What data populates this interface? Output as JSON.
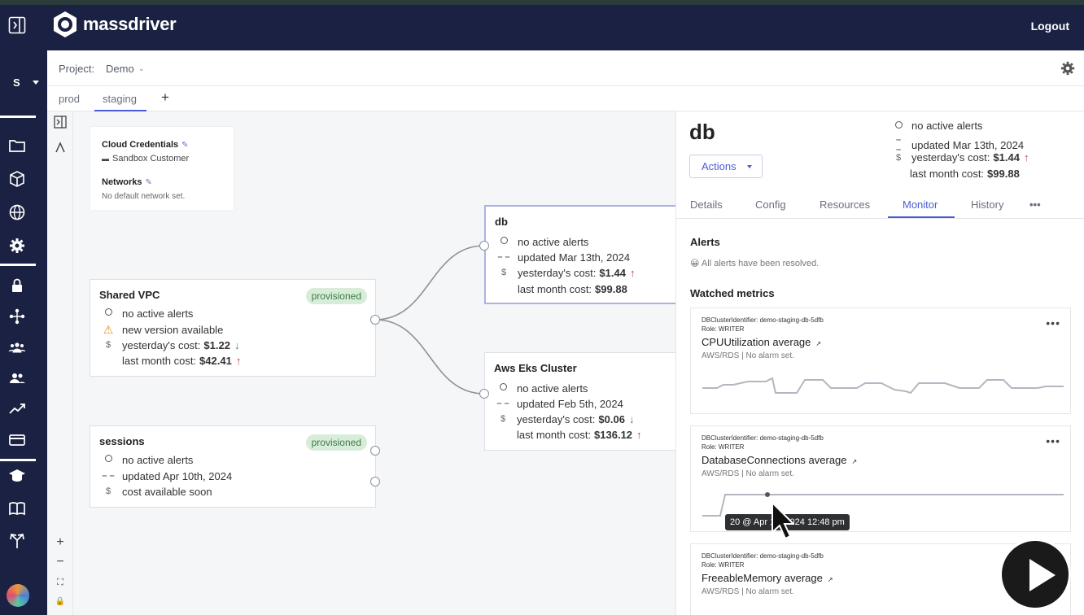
{
  "app": {
    "brand": "massdriver",
    "logout_label": "Logout",
    "org_initial": "S"
  },
  "project": {
    "label": "Project:",
    "name": "Demo",
    "chevron": "⌄"
  },
  "env_tabs": [
    {
      "label": "prod",
      "active": false
    },
    {
      "label": "staging",
      "active": true
    }
  ],
  "env_add_label": "+",
  "credentials": {
    "title": "Cloud Credentials",
    "value": "Sandbox Customer",
    "networks_title": "Networks",
    "networks_value": "No default network set."
  },
  "nodes": {
    "shared_vpc": {
      "title": "Shared VPC",
      "badge": "provisioned",
      "alerts": "no active alerts",
      "version": "new version available",
      "yesterday_label": "yesterday's cost:",
      "yesterday_value": "$1.22",
      "month_label": "last month cost:",
      "month_value": "$42.41"
    },
    "sessions": {
      "title": "sessions",
      "badge": "provisioned",
      "alerts": "no active alerts",
      "updated": "updated Apr 10th, 2024",
      "cost": "cost available soon"
    },
    "db": {
      "title": "db",
      "alerts": "no active alerts",
      "updated": "updated Mar 13th, 2024",
      "yesterday_label": "yesterday's cost:",
      "yesterday_value": "$1.44",
      "month_label": "last month cost:",
      "month_value": "$99.88"
    },
    "eks": {
      "title": "Aws Eks Cluster",
      "alerts": "no active alerts",
      "updated": "updated Feb 5th, 2024",
      "yesterday_label": "yesterday's cost:",
      "yesterday_value": "$0.06",
      "month_label": "last month cost:",
      "month_value": "$136.12"
    }
  },
  "canvas_tools": {
    "zoom_in": "+",
    "zoom_out": "−",
    "fit": "⛶",
    "lock": "🔒"
  },
  "panel": {
    "name": "db",
    "alerts": "no active alerts",
    "updated": "updated Mar 13th, 2024",
    "yesterday_label": "yesterday's cost:",
    "yesterday_value": "$1.44",
    "month_label": "last month cost:",
    "month_value": "$99.88",
    "actions_label": "Actions",
    "tabs": [
      "Details",
      "Config",
      "Resources",
      "Monitor",
      "History",
      "•••"
    ],
    "active_tab": "Monitor",
    "alerts_title": "Alerts",
    "alerts_resolved": "😀 All alerts have been resolved.",
    "watched_title": "Watched metrics",
    "metrics": [
      {
        "identifier": "DBClusterIdentifier: demo-staging-db-5dfb",
        "role": "Role: WRITER",
        "name": "CPUUtilization average",
        "source": "AWS/RDS | No alarm set."
      },
      {
        "identifier": "DBClusterIdentifier: demo-staging-db-5dfb",
        "role": "Role: WRITER",
        "name": "DatabaseConnections average",
        "source": "AWS/RDS | No alarm set.",
        "tooltip": "20 @ Apr 10, 2024 12:48 pm"
      },
      {
        "identifier": "DBClusterIdentifier: demo-staging-db-5dfb",
        "role": "Role: WRITER",
        "name": "FreeableMemory average",
        "source": "AWS/RDS | No alarm set."
      }
    ]
  },
  "colors": {
    "nav": "#1b2142",
    "accent": "#4b5bd5",
    "badge_bg": "#d7ecd9",
    "badge_text": "#3d7d47",
    "cost_up": "#c23a3a",
    "cost_down": "#3a8a4c"
  }
}
